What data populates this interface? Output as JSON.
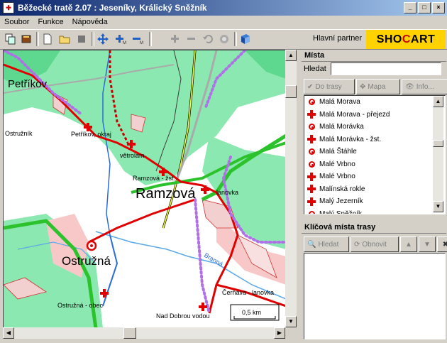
{
  "window": {
    "title": "Běžecké tratě 2.07 : Jeseníky, Králický Sněžník"
  },
  "menu": [
    "Soubor",
    "Funkce",
    "Nápověda"
  ],
  "toolbar_icons": [
    "copy-icon",
    "book-icon",
    "new-icon",
    "open-icon",
    "stop-icon",
    "move-icon",
    "zoom-in-icon",
    "zoom-out-icon",
    "add-point-icon",
    "remove-point-icon",
    "undo-icon",
    "record-icon",
    "help-book-icon"
  ],
  "partner": {
    "label": "Hlavní partner",
    "logo_a": "SHO",
    "logo_b": "C",
    "logo_c": "ART"
  },
  "map": {
    "labels": [
      "Petříkov",
      "Ostružník",
      "Petříkov, okraj",
      "větrolam",
      "Ramzová - žst.",
      "Ramzová",
      "lanovka",
      "Ostružná",
      "Branná",
      "Ostružná - obec",
      "Čerňava - lanovka",
      "Nad Dobrou vodou"
    ],
    "scale": "0,5 km"
  },
  "places": {
    "heading": "Místa",
    "search_label": "Hledat",
    "search_value": "",
    "btn_route": "Do trasy",
    "btn_map": "Mapa",
    "btn_info": "Info...",
    "items": [
      {
        "label": "Malá Morava",
        "type": "ring"
      },
      {
        "label": "Malá Morava - přejezd",
        "type": "cross"
      },
      {
        "label": "Malá Morávka",
        "type": "ring"
      },
      {
        "label": "Malá Morávka - žst.",
        "type": "cross"
      },
      {
        "label": "Malá Štáhle",
        "type": "ring"
      },
      {
        "label": "Malé Vrbno",
        "type": "ring"
      },
      {
        "label": "Malé Vrbno",
        "type": "cross"
      },
      {
        "label": "Malínská rokle",
        "type": "cross"
      },
      {
        "label": "Malý Jezerník",
        "type": "cross"
      },
      {
        "label": "Malý Sněžník",
        "type": "ring"
      }
    ]
  },
  "key_places": {
    "heading": "Klíčová místa trasy",
    "btn_find": "Hledat",
    "btn_refresh": "Obnovit"
  }
}
